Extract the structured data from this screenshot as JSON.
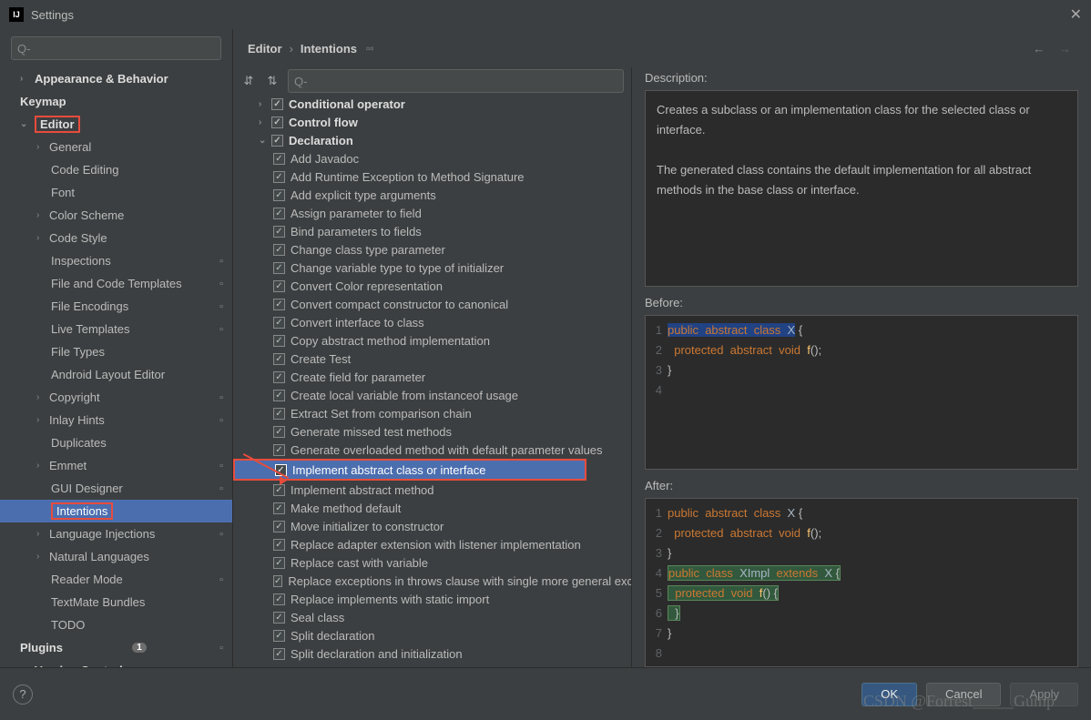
{
  "window": {
    "title": "Settings"
  },
  "search": {
    "placeholder": "Q-"
  },
  "breadcrumb": {
    "root": "Editor",
    "leaf": "Intentions"
  },
  "sidebar": [
    {
      "label": "Appearance & Behavior",
      "lvl": 0,
      "bold": true,
      "chev": "›"
    },
    {
      "label": "Keymap",
      "lvl": 0,
      "bold": true
    },
    {
      "label": "Editor",
      "lvl": 0,
      "bold": true,
      "chev": "⌄",
      "red": true
    },
    {
      "label": "General",
      "lvl": 1,
      "chev": "›"
    },
    {
      "label": "Code Editing",
      "lvl": 2
    },
    {
      "label": "Font",
      "lvl": 2
    },
    {
      "label": "Color Scheme",
      "lvl": 1,
      "chev": "›"
    },
    {
      "label": "Code Style",
      "lvl": 1,
      "chev": "›"
    },
    {
      "label": "Inspections",
      "lvl": 2,
      "gear": true
    },
    {
      "label": "File and Code Templates",
      "lvl": 2,
      "gear": true
    },
    {
      "label": "File Encodings",
      "lvl": 2,
      "gear": true
    },
    {
      "label": "Live Templates",
      "lvl": 2,
      "gear": true
    },
    {
      "label": "File Types",
      "lvl": 2
    },
    {
      "label": "Android Layout Editor",
      "lvl": 2
    },
    {
      "label": "Copyright",
      "lvl": 1,
      "chev": "›",
      "gear": true
    },
    {
      "label": "Inlay Hints",
      "lvl": 1,
      "chev": "›",
      "gear": true
    },
    {
      "label": "Duplicates",
      "lvl": 2
    },
    {
      "label": "Emmet",
      "lvl": 1,
      "chev": "›",
      "gear": true
    },
    {
      "label": "GUI Designer",
      "lvl": 2,
      "gear": true
    },
    {
      "label": "Intentions",
      "lvl": 2,
      "selected": true,
      "red": true
    },
    {
      "label": "Language Injections",
      "lvl": 1,
      "chev": "›",
      "gear": true
    },
    {
      "label": "Natural Languages",
      "lvl": 1,
      "chev": "›"
    },
    {
      "label": "Reader Mode",
      "lvl": 2,
      "gear": true
    },
    {
      "label": "TextMate Bundles",
      "lvl": 2
    },
    {
      "label": "TODO",
      "lvl": 2
    },
    {
      "label": "Plugins",
      "lvl": 0,
      "bold": true,
      "badge": "1",
      "gear": true
    },
    {
      "label": "Version Control",
      "lvl": 0,
      "bold": true,
      "chev": "›",
      "gear": true
    }
  ],
  "intentions": [
    {
      "label": "Conditional operator",
      "d": 0,
      "bold": true,
      "chev": "›"
    },
    {
      "label": "Control flow",
      "d": 0,
      "bold": true,
      "chev": "›"
    },
    {
      "label": "Declaration",
      "d": 0,
      "bold": true,
      "chev": "⌄"
    },
    {
      "label": "Add Javadoc",
      "d": 1
    },
    {
      "label": "Add Runtime Exception to Method Signature",
      "d": 1
    },
    {
      "label": "Add explicit type arguments",
      "d": 1
    },
    {
      "label": "Assign parameter to field",
      "d": 1
    },
    {
      "label": "Bind parameters to fields",
      "d": 1
    },
    {
      "label": "Change class type parameter",
      "d": 1
    },
    {
      "label": "Change variable type to type of initializer",
      "d": 1
    },
    {
      "label": "Convert Color representation",
      "d": 1
    },
    {
      "label": "Convert compact constructor to canonical",
      "d": 1
    },
    {
      "label": "Convert interface to class",
      "d": 1
    },
    {
      "label": "Copy abstract method implementation",
      "d": 1
    },
    {
      "label": "Create Test",
      "d": 1
    },
    {
      "label": "Create field for parameter",
      "d": 1
    },
    {
      "label": "Create local variable from instanceof usage",
      "d": 1
    },
    {
      "label": "Extract Set from comparison chain",
      "d": 1
    },
    {
      "label": "Generate missed test methods",
      "d": 1
    },
    {
      "label": "Generate overloaded method with default parameter values",
      "d": 1
    },
    {
      "label": "Implement abstract class or interface",
      "d": 1,
      "sel": true,
      "red": true
    },
    {
      "label": "Implement abstract method",
      "d": 1
    },
    {
      "label": "Make method default",
      "d": 1
    },
    {
      "label": "Move initializer to constructor",
      "d": 1
    },
    {
      "label": "Replace adapter extension with listener implementation",
      "d": 1
    },
    {
      "label": "Replace cast with variable",
      "d": 1
    },
    {
      "label": "Replace exceptions in throws clause with single more general exception",
      "d": 1
    },
    {
      "label": "Replace implements with static import",
      "d": 1
    },
    {
      "label": "Seal class",
      "d": 1
    },
    {
      "label": "Split declaration",
      "d": 1
    },
    {
      "label": "Split declaration and initialization",
      "d": 1
    }
  ],
  "description": {
    "title": "Description:",
    "p1": "Creates a subclass or an implementation class for the selected class or interface.",
    "p2": "The generated class contains the default implementation for all abstract methods in the base class or interface."
  },
  "before": {
    "title": "Before:",
    "lines": [
      {
        "n": "1",
        "html": "<span class='hl'><span class='kw'>public</span>  <span class='kw'>abstract</span>  <span class='kw'>class</span>  <span class='id'>X</span></span> {"
      },
      {
        "n": "2",
        "html": "  <span class='kw'>protected</span>  <span class='kw'>abstract</span>  <span class='kw'>void</span>  <span class='fn'>f</span>();"
      },
      {
        "n": "3",
        "html": "}"
      },
      {
        "n": "4",
        "html": ""
      }
    ]
  },
  "after": {
    "title": "After:",
    "lines": [
      {
        "n": "1",
        "html": "<span class='kw'>public</span>  <span class='kw'>abstract</span>  <span class='kw'>class</span>  <span class='id'>X</span> {"
      },
      {
        "n": "2",
        "html": "  <span class='kw'>protected</span>  <span class='kw'>abstract</span>  <span class='kw'>void</span>  <span class='fn'>f</span>();"
      },
      {
        "n": "3",
        "html": "}"
      },
      {
        "n": "4",
        "html": "<span class='hl2'><span class='kw'>public</span>  <span class='kw'>class</span>  <span class='id'>XImpl</span>  <span class='kw'>extends</span>  <span class='id'>X</span> {</span>"
      },
      {
        "n": "5",
        "html": "<span class='hl2'>  <span class='kw'>protected</span>  <span class='kw'>void</span>  <span class='fn'>f</span>() {</span>"
      },
      {
        "n": "6",
        "html": "<span class='hl2'>  }</span>"
      },
      {
        "n": "7",
        "html": "}"
      },
      {
        "n": "8",
        "html": ""
      }
    ]
  },
  "buttons": {
    "ok": "OK",
    "cancel": "Cancel",
    "apply": "Apply"
  },
  "watermark": "CSDN @Forrest_____Gump"
}
